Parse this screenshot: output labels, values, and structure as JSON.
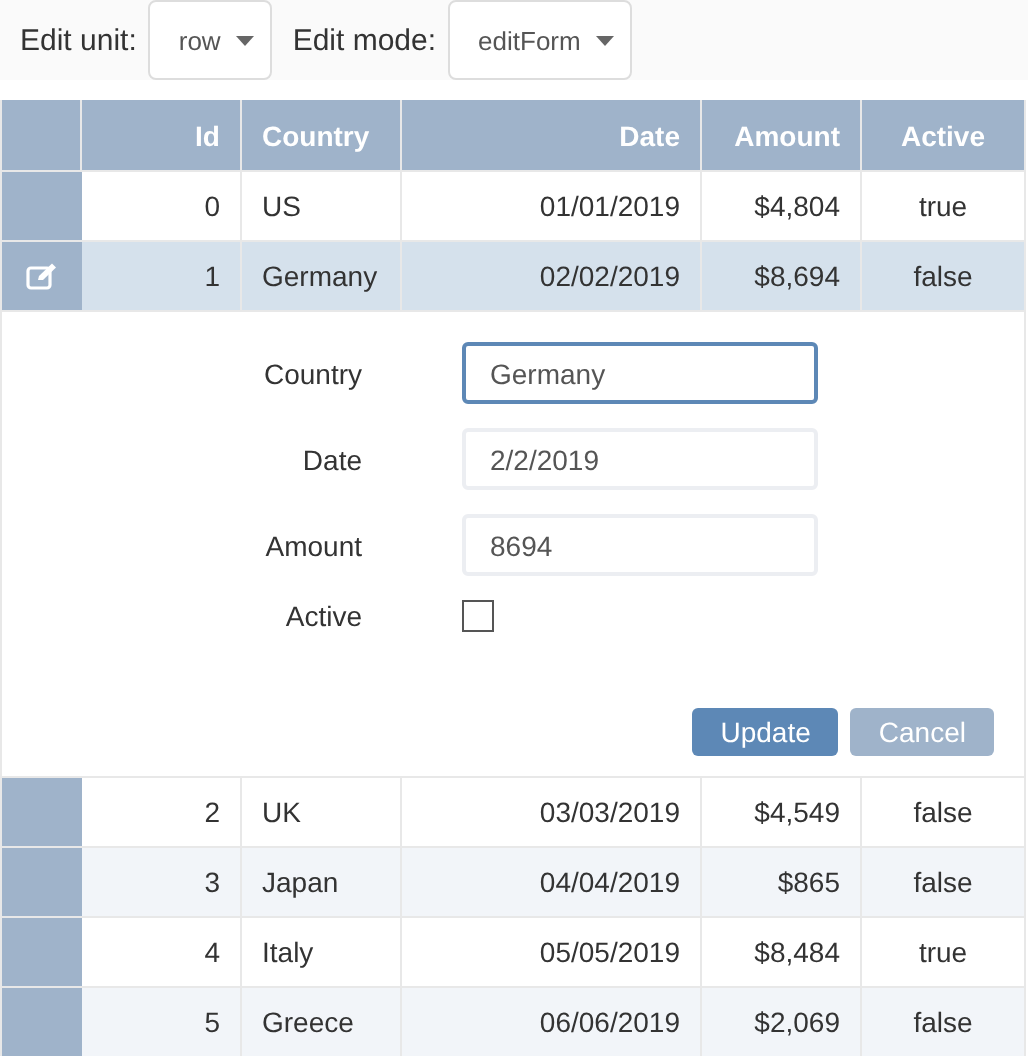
{
  "toolbar": [
    {
      "label": "Edit unit:",
      "value": "row"
    },
    {
      "label": "Edit mode:",
      "value": "editForm"
    }
  ],
  "table": {
    "columns": [
      {
        "label": "Id",
        "kind": "number"
      },
      {
        "label": "Country",
        "kind": "text"
      },
      {
        "label": "Date",
        "kind": "date"
      },
      {
        "label": "Amount",
        "kind": "number"
      },
      {
        "label": "Active",
        "kind": "boolean"
      }
    ],
    "rows": [
      {
        "cells": [
          "0",
          "US",
          "01/01/2019",
          "$4,804",
          "true"
        ],
        "selected": false
      },
      {
        "cells": [
          "1",
          "Germany",
          "02/02/2019",
          "$8,694",
          "false"
        ],
        "selected": true
      },
      {
        "cells": [
          "2",
          "UK",
          "03/03/2019",
          "$4,549",
          "false"
        ],
        "selected": false
      },
      {
        "cells": [
          "3",
          "Japan",
          "04/04/2019",
          "$865",
          "false"
        ],
        "selected": false
      },
      {
        "cells": [
          "4",
          "Italy",
          "05/05/2019",
          "$8,484",
          "true"
        ],
        "selected": false
      },
      {
        "cells": [
          "5",
          "Greece",
          "06/06/2019",
          "$2,069",
          "false"
        ],
        "selected": false
      }
    ]
  },
  "edit_form": {
    "fields": [
      {
        "kind": "text",
        "label": "Country",
        "value": "Germany",
        "focused": true
      },
      {
        "kind": "text",
        "label": "Date",
        "value": "2/2/2019",
        "focused": false
      },
      {
        "kind": "text",
        "label": "Amount",
        "value": "8694",
        "focused": false
      },
      {
        "kind": "checkbox",
        "label": "Active",
        "checked": false
      }
    ],
    "buttons": [
      {
        "label": "Update",
        "primary": true
      },
      {
        "label": "Cancel",
        "primary": false
      }
    ]
  }
}
